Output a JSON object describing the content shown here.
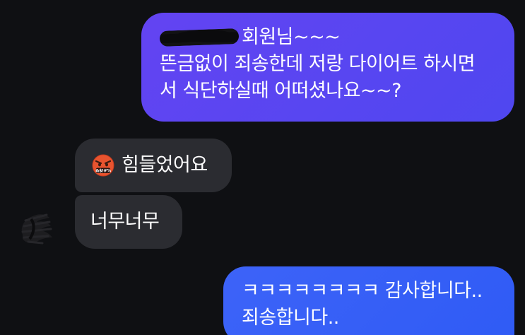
{
  "chat": {
    "messages": [
      {
        "direction": "outgoing",
        "line1_suffix": "회원님~~~",
        "lines": [
          "뜬금없이 죄송한데 저랑 다이어트 하시면",
          "서 식단하실때 어떠셨나요~~?"
        ]
      },
      {
        "direction": "incoming",
        "emoji_icon": "face-with-symbols-over-mouth-icon",
        "text": "힘들었어요"
      },
      {
        "direction": "incoming",
        "text": "너무너무"
      },
      {
        "direction": "outgoing",
        "lines": [
          "ㅋㅋㅋㅋㅋㅋㅋㅋ 감사합니다..",
          "죄송합니다.."
        ]
      }
    ]
  },
  "colors": {
    "background": "#0f1013",
    "outgoing_bubble_1": "#5a46f1",
    "outgoing_bubble_2": "#3660f6",
    "incoming_bubble": "#2b2c31",
    "text": "#ffffff"
  }
}
